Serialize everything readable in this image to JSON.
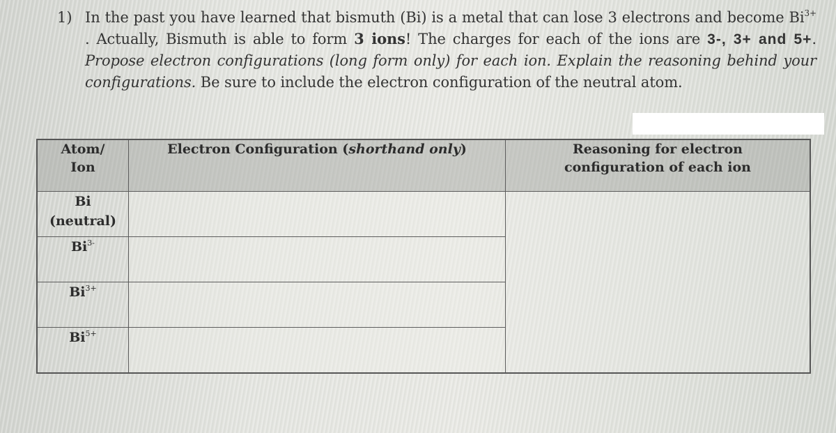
{
  "question": {
    "number": "1)",
    "line1_text": "In the past you have learned that bismuth (Bi) is a metal that can lose 3 electrons and become Bi",
    "line1_charge": "3+",
    "sentence2_pre": " .  Actually, Bismuth is able to form ",
    "sentence2_bold": "3 ions",
    "sentence2_post": "!  The charges for each of the ions are ",
    "charges_bold": "3-, 3+ and 5+",
    "charges_post": ".  ",
    "instruction_italic": "Propose electron configurations (long form only) for each ion.  Explain the reasoning behind your configurations.",
    "closing": " Be sure to include the electron configuration of the neutral atom."
  },
  "table": {
    "headers": {
      "atom_ion_line1": "Atom/",
      "atom_ion_line2": "Ion",
      "config_main": "Electron Configuration (",
      "config_italic": "shorthand only",
      "config_close": ")",
      "reasoning_line1": "Reasoning for electron",
      "reasoning_line2": "configuration of each ion"
    },
    "rows": [
      {
        "symbol": "Bi",
        "charge": "",
        "note": "(neutral)",
        "configuration": ""
      },
      {
        "symbol": "Bi",
        "charge": "3-",
        "note": "",
        "configuration": ""
      },
      {
        "symbol": "Bi",
        "charge": "3+",
        "note": "",
        "configuration": ""
      },
      {
        "symbol": "Bi",
        "charge": "5+",
        "note": "",
        "configuration": ""
      }
    ],
    "reasoning": ""
  }
}
